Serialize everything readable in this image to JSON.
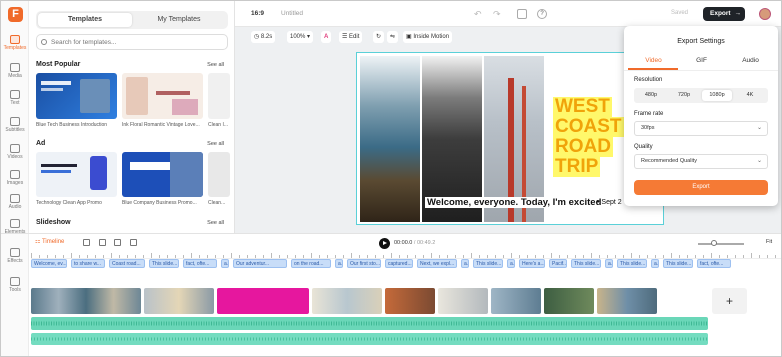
{
  "rail": {
    "logo": "F",
    "items": [
      {
        "label": "Templates",
        "icon": "templates-icon"
      },
      {
        "label": "Media",
        "icon": "media-icon"
      },
      {
        "label": "Text",
        "icon": "text-icon"
      },
      {
        "label": "Subtitles",
        "icon": "subtitles-icon"
      },
      {
        "label": "Videos",
        "icon": "videos-icon"
      },
      {
        "label": "Images",
        "icon": "images-icon"
      },
      {
        "label": "Audio",
        "icon": "audio-icon"
      },
      {
        "label": "Elements",
        "icon": "elements-icon"
      },
      {
        "label": "Effects",
        "icon": "effects-icon"
      },
      {
        "label": "Tools",
        "icon": "tools-icon"
      }
    ]
  },
  "panel": {
    "tabs": [
      "Templates",
      "My Templates"
    ],
    "search_placeholder": "Search for templates...",
    "sections": [
      {
        "title": "Most Popular",
        "see_all": "See all",
        "items": [
          "Blue Tech Business Introduction",
          "Ink Floral Romantic Vintage Love...",
          "Clean I..."
        ]
      },
      {
        "title": "Ad",
        "see_all": "See all",
        "items": [
          "Technology Clean App Promo",
          "Blue Company Business Promo...",
          "Clean..."
        ]
      },
      {
        "title": "Slideshow",
        "see_all": "See all",
        "items": []
      }
    ]
  },
  "topbar": {
    "ratio": "16:9",
    "title": "Untitled",
    "saved": "Saved",
    "export": "Export"
  },
  "toolbar": {
    "duration": "8.2s",
    "zoom": "100%",
    "edit": "Edit",
    "motion": "Inside Motion"
  },
  "stage": {
    "headline": [
      "WEST",
      "COAST",
      "ROAD",
      "TRIP"
    ],
    "caption": "Welcome, everyone. Today, I'm excited",
    "caption_suffix": "• Sept 2"
  },
  "export_settings": {
    "title": "Export Settings",
    "tabs": [
      "Video",
      "GIF",
      "Audio"
    ],
    "resolution_label": "Resolution",
    "resolutions": [
      "480p",
      "720p",
      "1080p",
      "4K"
    ],
    "selected_resolution": "1080p",
    "frame_rate_label": "Frame rate",
    "frame_rate": "30fps",
    "quality_label": "Quality",
    "quality": "Recommended Quality",
    "button": "Export"
  },
  "timeline": {
    "tab": "Timeline",
    "time_current": "00:00.0",
    "time_total": "/ 00:49.2",
    "fit": "Fit",
    "subtitle_chips": [
      "Welcome, ev...",
      "to share w...",
      "Coast road...",
      "This slide...",
      "fact, ofte...",
      "a...",
      "Our adventur...",
      "on the road...",
      "a...",
      "Our first sto...",
      "captured...",
      "Next, we expl...",
      "a...",
      "This slide...",
      "a...",
      "Here's a...",
      "Pacif...",
      "This slide...",
      "a...",
      "This slide...",
      "a...",
      "This slide...",
      "fact, ofte..."
    ],
    "add": "+"
  },
  "colors": {
    "accent": "#f06a2a",
    "dark": "#1f2328",
    "teal": "#6ad7b8",
    "chip": "#c8ddf8",
    "magenta": "#e6179e"
  }
}
